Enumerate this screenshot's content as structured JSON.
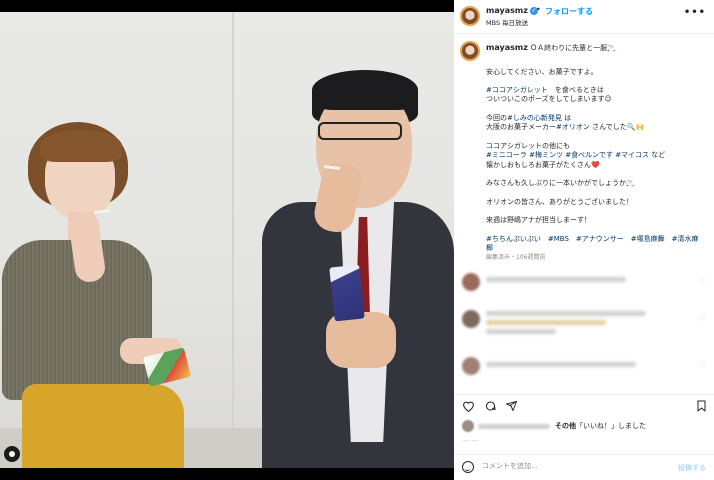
{
  "post": {
    "username": "mayasmz",
    "verified_mark": "✓",
    "dot": "•",
    "follow_label": "フォローする",
    "location": "MBS 毎日放送",
    "more_label": "•••"
  },
  "caption": {
    "username": "mayasmz",
    "lines": [
      {
        "segments": [
          {
            "t": "ＯＡ終わりに先輩と一服🚬",
            "tag": false
          }
        ]
      },
      {
        "segments": [
          {
            "t": "",
            "tag": false
          }
        ]
      },
      {
        "segments": [
          {
            "t": "安心してください、お菓子ですよ。",
            "tag": false
          }
        ]
      },
      {
        "segments": [
          {
            "t": "",
            "tag": false
          }
        ]
      },
      {
        "segments": [
          {
            "t": "#ココアシガレット",
            "tag": true
          },
          {
            "t": "　を食べるときは",
            "tag": false
          }
        ]
      },
      {
        "segments": [
          {
            "t": "ついついこのポーズをしてしまいます😉",
            "tag": false
          }
        ]
      },
      {
        "segments": [
          {
            "t": "",
            "tag": false
          }
        ]
      },
      {
        "segments": [
          {
            "t": "今回の",
            "tag": false
          },
          {
            "t": "#しみの心新発見",
            "tag": true
          },
          {
            "t": " は",
            "tag": false
          }
        ]
      },
      {
        "segments": [
          {
            "t": "大阪のお菓子メーカー",
            "tag": false
          },
          {
            "t": "#オリオン",
            "tag": true
          },
          {
            "t": " さんでした🔍🙌",
            "tag": false
          }
        ]
      },
      {
        "segments": [
          {
            "t": "",
            "tag": false
          }
        ]
      },
      {
        "segments": [
          {
            "t": "ココアシガレットの他にも",
            "tag": false
          }
        ]
      },
      {
        "segments": [
          {
            "t": "#ミニコーラ",
            "tag": true
          },
          {
            "t": " ",
            "tag": false
          },
          {
            "t": "#梅ミンツ",
            "tag": true
          },
          {
            "t": " ",
            "tag": false
          },
          {
            "t": "#食べルンです",
            "tag": true
          },
          {
            "t": " ",
            "tag": false
          },
          {
            "t": "#マイコス",
            "tag": true
          },
          {
            "t": " など",
            "tag": false
          }
        ]
      },
      {
        "segments": [
          {
            "t": "懐かしおもしろお菓子がたくさん❤️",
            "tag": false
          }
        ]
      },
      {
        "segments": [
          {
            "t": "",
            "tag": false
          }
        ]
      },
      {
        "segments": [
          {
            "t": "みなさんも久しぶりに一本いかがでしょうか🚬",
            "tag": false
          }
        ]
      },
      {
        "segments": [
          {
            "t": "",
            "tag": false
          }
        ]
      },
      {
        "segments": [
          {
            "t": "オリオンの皆さん、ありがとうございました！",
            "tag": false
          }
        ]
      },
      {
        "segments": [
          {
            "t": "",
            "tag": false
          }
        ]
      },
      {
        "segments": [
          {
            "t": "来週は野嶋アナが担当しまーす！",
            "tag": false
          }
        ]
      },
      {
        "segments": [
          {
            "t": "",
            "tag": false
          }
        ]
      },
      {
        "segments": [
          {
            "t": "#ちちんぷいぷい",
            "tag": true
          },
          {
            "t": "　",
            "tag": false
          },
          {
            "t": "#MBS",
            "tag": true
          },
          {
            "t": "　",
            "tag": false
          },
          {
            "t": "#アナウンサー",
            "tag": true
          },
          {
            "t": "　",
            "tag": false
          },
          {
            "t": "#塚島麻舞",
            "tag": true
          },
          {
            "t": "　",
            "tag": false
          },
          {
            "t": "#清水麻",
            "tag": true
          }
        ]
      },
      {
        "segments": [
          {
            "t": "椰",
            "tag": true
          }
        ]
      }
    ],
    "meta": "編集済み・106週間前"
  },
  "actions": {
    "like_icon": "heart-icon",
    "comment_icon": "comment-icon",
    "share_icon": "share-icon",
    "save_icon": "bookmark-icon"
  },
  "likes": {
    "prefix": "その他",
    "quoted": "「いいね！」",
    "suffix": "しました"
  },
  "composer": {
    "placeholder": "コメントを追加...",
    "post_label": "投稿する"
  }
}
